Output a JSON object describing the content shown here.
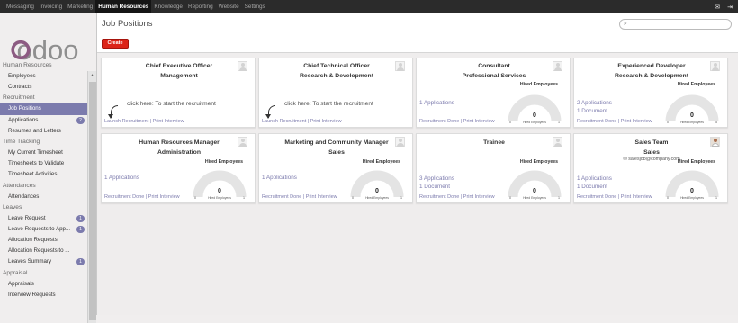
{
  "topmenu": [
    "Messaging",
    "Invoicing",
    "Marketing",
    "Human Resources",
    "Knowledge",
    "Reporting",
    "Website",
    "Settings"
  ],
  "topmenu_active": "Human Resources",
  "topicons": {
    "messages": "✉",
    "logout": "⇥"
  },
  "logo": "odoo",
  "sidebar": [
    {
      "type": "section",
      "label": "Human Resources"
    },
    {
      "type": "item",
      "label": "Employees"
    },
    {
      "type": "item",
      "label": "Contracts"
    },
    {
      "type": "section",
      "label": "Recruitment"
    },
    {
      "type": "item",
      "label": "Job Positions",
      "active": true
    },
    {
      "type": "item",
      "label": "Applications",
      "badge": "2"
    },
    {
      "type": "item",
      "label": "Resumes and Letters"
    },
    {
      "type": "section",
      "label": "Time Tracking"
    },
    {
      "type": "item",
      "label": "My Current Timesheet"
    },
    {
      "type": "item",
      "label": "Timesheets to Validate"
    },
    {
      "type": "item",
      "label": "Timesheet Activities"
    },
    {
      "type": "section",
      "label": "Attendances"
    },
    {
      "type": "item",
      "label": "Attendances"
    },
    {
      "type": "section",
      "label": "Leaves"
    },
    {
      "type": "item",
      "label": "Leave Request",
      "badge": "1"
    },
    {
      "type": "item",
      "label": "Leave Requests to App...",
      "badge": "1"
    },
    {
      "type": "item",
      "label": "Allocation Requests"
    },
    {
      "type": "item",
      "label": "Allocation Requests to ..."
    },
    {
      "type": "item",
      "label": "Leaves Summary",
      "badge": "1"
    },
    {
      "type": "section",
      "label": "Appraisal"
    },
    {
      "type": "item",
      "label": "Appraisals"
    },
    {
      "type": "item",
      "label": "Interview Requests"
    }
  ],
  "header": {
    "title": "Job Positions",
    "create_label": "Create",
    "search_placeholder": ""
  },
  "cards": [
    {
      "title": "Chief Executive Officer",
      "dept": "Management",
      "kind": "launch",
      "click": "click here: To start the recruitment",
      "links": "Launch Recruitment | Print Interview"
    },
    {
      "title": "Chief Technical Officer",
      "dept": "Research & Development",
      "kind": "launch",
      "click": "click here: To start the recruitment",
      "links": "Launch Recruitment | Print Interview"
    },
    {
      "title": "Consultant",
      "dept": "Professional Services",
      "kind": "gauge",
      "apps": [
        "1 Applications"
      ],
      "hired_label": "Hired Employees",
      "hired": 0,
      "gauge_caption": "Hired Employees",
      "gauge_min": "0",
      "gauge_max": "1",
      "links": "Recruitment Done | Print Interview"
    },
    {
      "title": "Experienced Developer",
      "dept": "Research & Development",
      "kind": "gauge",
      "apps": [
        "2 Applications",
        "1 Document"
      ],
      "hired_label": "Hired Employees",
      "hired": 0,
      "gauge_caption": "Hired Employees",
      "gauge_min": "0",
      "gauge_max": "5",
      "links": "Recruitment Done | Print Interview"
    },
    {
      "title": "Human Resources Manager",
      "dept": "Administration",
      "kind": "gauge",
      "apps": [
        "1 Applications"
      ],
      "hired_label": "Hired Employees",
      "hired": 0,
      "gauge_caption": "Hired Employees",
      "gauge_min": "0",
      "gauge_max": "1",
      "links": "Recruitment Done | Print Interview"
    },
    {
      "title": "Marketing and Community Manager",
      "dept": "Sales",
      "kind": "gauge",
      "apps": [
        "1 Applications"
      ],
      "hired_label": "Hired Employees",
      "hired": 0,
      "gauge_caption": "Hired Employees",
      "gauge_min": "0",
      "gauge_max": "1",
      "links": "Recruitment Done | Print Interview"
    },
    {
      "title": "Trainee",
      "dept": "",
      "kind": "gauge",
      "apps": [
        "3 Applications",
        "1 Document"
      ],
      "hired_label": "Hired Employees",
      "hired": 0,
      "gauge_caption": "Hired Employees",
      "gauge_min": "0",
      "gauge_max": "1",
      "links": "Recruitment Done | Print Interview"
    },
    {
      "title": "Sales Team",
      "dept": "Sales",
      "kind": "gauge",
      "email": "✉ salesjob@company.com",
      "avatar": "photo",
      "apps": [
        "1 Applications",
        "1 Document"
      ],
      "hired_label": "Hired Employees",
      "hired": 0,
      "gauge_caption": "Hired Employees",
      "gauge_min": "0",
      "gauge_max": "1",
      "links": "Recruitment Done | Print Interview"
    }
  ],
  "colors": {
    "accent": "#7c7bad",
    "create": "#dc2418",
    "gauge_track": "#e4e4e4"
  }
}
